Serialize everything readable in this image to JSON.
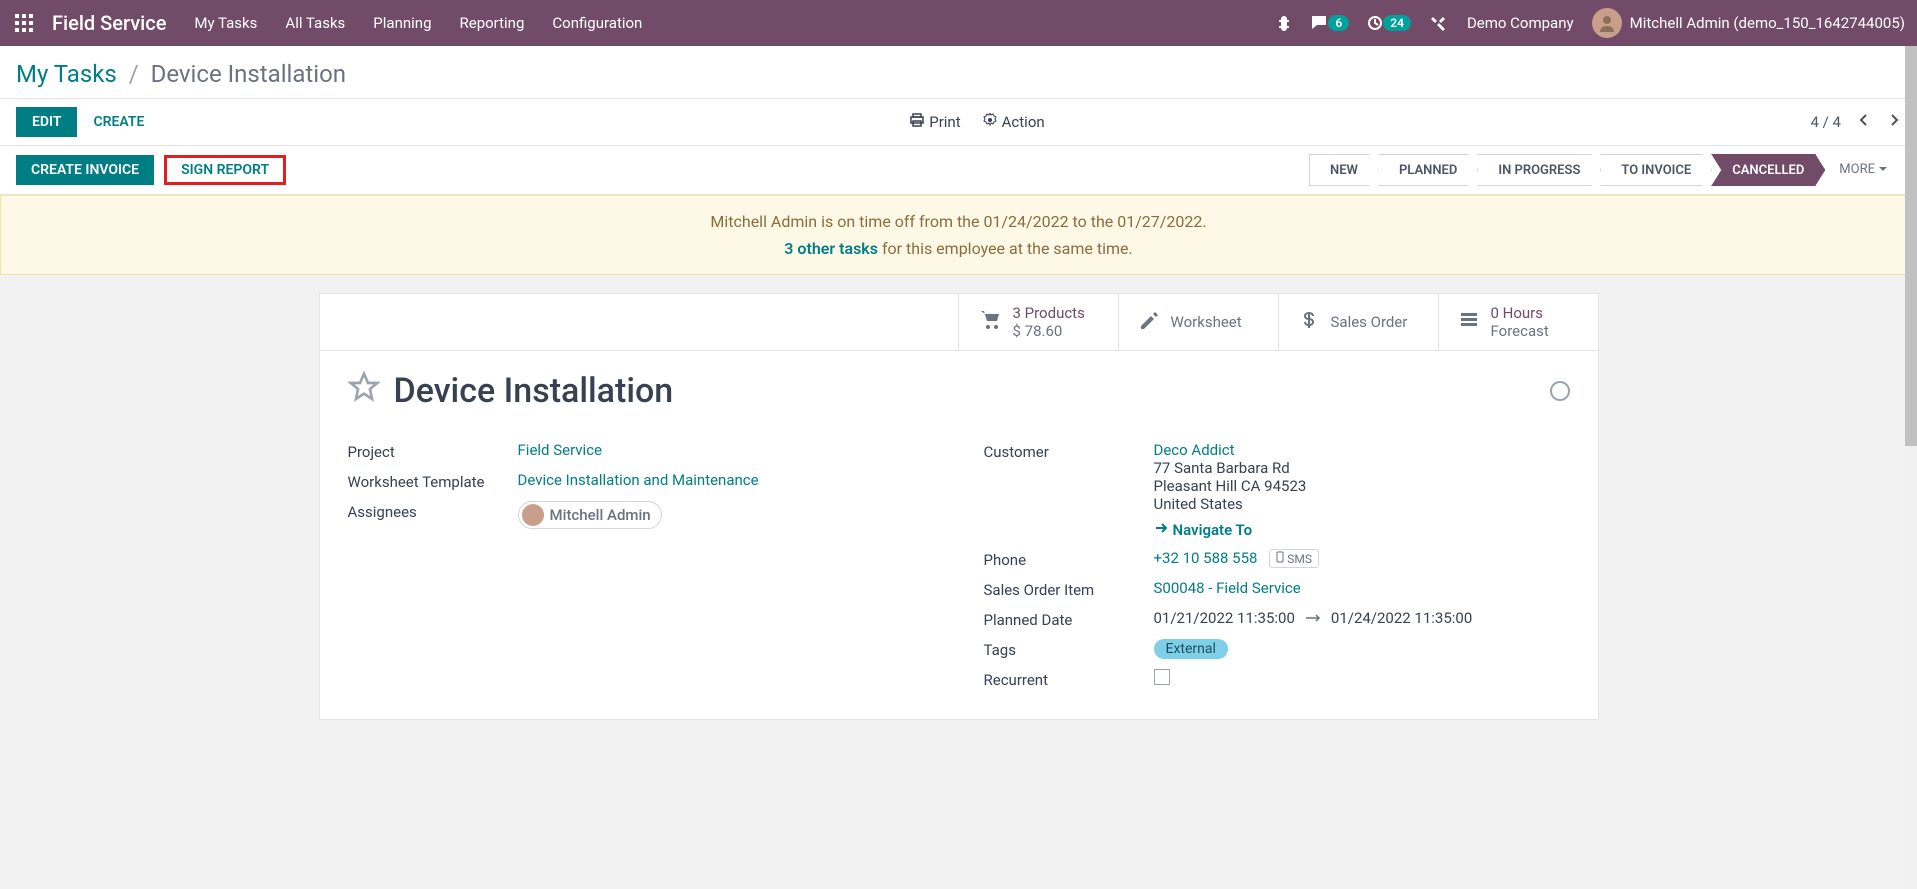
{
  "nav": {
    "brand": "Field Service",
    "links": [
      "My Tasks",
      "All Tasks",
      "Planning",
      "Reporting",
      "Configuration"
    ],
    "chat_count": "6",
    "activity_count": "24",
    "company": "Demo Company",
    "user_name": "Mitchell Admin (demo_150_1642744005)"
  },
  "breadcrumb": {
    "parent": "My Tasks",
    "sep": "/",
    "current": "Device Installation"
  },
  "controls": {
    "edit": "EDIT",
    "create": "CREATE",
    "print": "Print",
    "action": "Action",
    "pager": "4 / 4"
  },
  "status": {
    "create_invoice": "CREATE INVOICE",
    "sign_report": "SIGN REPORT",
    "steps": [
      "NEW",
      "PLANNED",
      "IN PROGRESS",
      "TO INVOICE",
      "CANCELLED"
    ],
    "more": "MORE"
  },
  "banner": {
    "line1": "Mitchell Admin is on time off from the 01/24/2022 to the 01/27/2022.",
    "link": "3 other tasks",
    "text2": " for this employee at the same time."
  },
  "stats": {
    "products": {
      "line1": "3 Products",
      "line2": "$ 78.60"
    },
    "worksheet": {
      "label": "Worksheet"
    },
    "sales_order": {
      "label": "Sales Order"
    },
    "forecast": {
      "line1": "0  Hours",
      "line2": "Forecast"
    }
  },
  "task": {
    "title": "Device Installation"
  },
  "left_fields": {
    "project_label": "Project",
    "project_value": "Field Service",
    "template_label": "Worksheet Template",
    "template_value": "Device Installation and Maintenance",
    "assignees_label": "Assignees",
    "assignee_chip": "Mitchell Admin"
  },
  "right_fields": {
    "customer_label": "Customer",
    "customer_name": "Deco Addict",
    "addr1": "77 Santa Barbara Rd",
    "addr2": "Pleasant Hill CA 94523",
    "addr3": "United States",
    "navigate": "Navigate To",
    "phone_label": "Phone",
    "phone_value": "+32 10 588 558",
    "sms_label": "SMS",
    "soi_label": "Sales Order Item",
    "soi_value": "S00048 - Field Service",
    "planned_label": "Planned Date",
    "planned_from": "01/21/2022 11:35:00",
    "planned_to": "01/24/2022 11:35:00",
    "tags_label": "Tags",
    "tag_value": "External",
    "recurrent_label": "Recurrent"
  }
}
